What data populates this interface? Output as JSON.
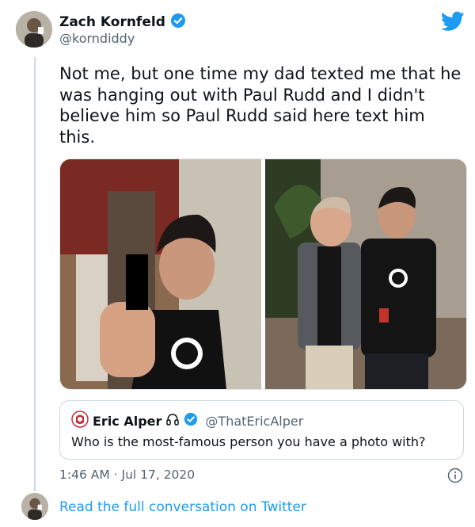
{
  "tweet": {
    "author_name": "Zach Kornfeld",
    "author_handle": "@korndiddy",
    "text": "Not me, but one time my dad texted me that he was hanging out with Paul Rudd and I didn't believe him so Paul Rudd said here text him this.",
    "timestamp": "1:46 AM · Jul 17, 2020",
    "verified_icon": "verified-badge-icon",
    "brand_color": "#1d9bf0"
  },
  "quote": {
    "author_name": "Eric Alper",
    "author_handle": "@ThatEricAlper",
    "text": "Who is the most-famous person you have a photo with?",
    "extra_icon": "headphones-icon"
  },
  "footer": {
    "read_more": "Read the full conversation on Twitter"
  }
}
